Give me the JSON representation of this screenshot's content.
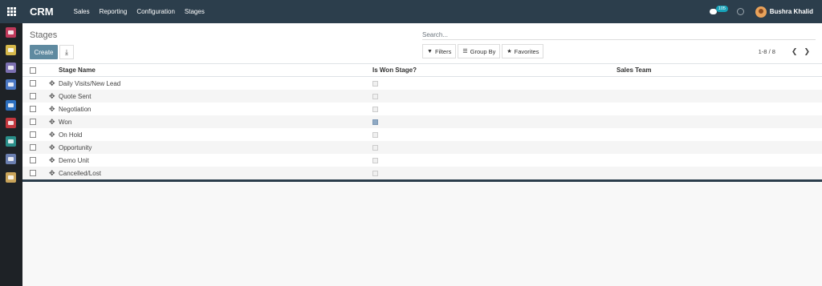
{
  "app": {
    "brand": "CRM"
  },
  "menu": [
    {
      "label": "Sales"
    },
    {
      "label": "Reporting"
    },
    {
      "label": "Configuration"
    },
    {
      "label": "Stages"
    }
  ],
  "topbar": {
    "messages_count": "105",
    "user_name": "Bushra Khalid"
  },
  "sidebar": {
    "icons": [
      {
        "name": "discuss-icon",
        "color": "#c0395a"
      },
      {
        "name": "notes-icon",
        "color": "#d6b84a"
      },
      {
        "name": "contacts-icon",
        "color": "#7b6fb0"
      },
      {
        "name": "settings-icon",
        "color": "#4a78c4"
      },
      {
        "name": "crm-icon",
        "color": "#2c6fbf"
      },
      {
        "name": "timesheet-icon",
        "color": "#c2373e"
      },
      {
        "name": "employees-icon",
        "color": "#2a8f8a"
      },
      {
        "name": "search-docs-icon",
        "color": "#6b7fb0"
      },
      {
        "name": "expenses-icon",
        "color": "#c9a45a"
      }
    ]
  },
  "control": {
    "title": "Stages",
    "create_label": "Create",
    "search_placeholder": "Search...",
    "filters_label": "Filters",
    "groupby_label": "Group By",
    "favorites_label": "Favorites",
    "pager_value": "1-8 / 8"
  },
  "list": {
    "columns": {
      "stage_name": "Stage Name",
      "is_won": "Is Won Stage?",
      "sales_team": "Sales Team"
    },
    "rows": [
      {
        "name": "Daily Visits/New Lead",
        "is_won": false
      },
      {
        "name": "Quote Sent",
        "is_won": false
      },
      {
        "name": "Negotiation",
        "is_won": false
      },
      {
        "name": "Won",
        "is_won": true
      },
      {
        "name": "On Hold",
        "is_won": false
      },
      {
        "name": "Opportunity",
        "is_won": false
      },
      {
        "name": "Demo Unit",
        "is_won": false
      },
      {
        "name": "Cancelled/Lost",
        "is_won": false
      }
    ]
  }
}
